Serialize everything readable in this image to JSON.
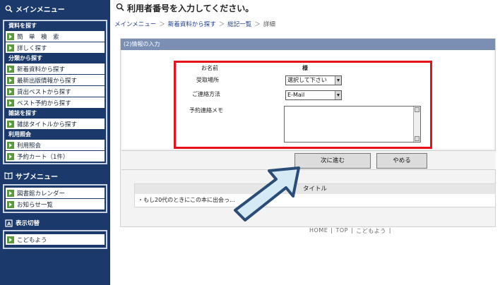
{
  "sidebar": {
    "main_menu_title": "メインメニュー",
    "sections": [
      {
        "label": "資料を探す",
        "items": [
          "簡　単　検　索",
          "詳しく探す"
        ]
      },
      {
        "label": "分類から探す",
        "items": [
          "新着資料から探す",
          "最新出版情報から探す",
          "貸出ベストから探す",
          "ベスト予約から探す"
        ]
      },
      {
        "label": "雑誌を探す",
        "items": [
          "雑誌タイトルから探す"
        ]
      },
      {
        "label": "利用照会",
        "items": [
          "利用照会",
          "予約カート（1件）"
        ]
      }
    ],
    "sub_menu_title": "サブメニュー",
    "sub_items": [
      "図書館カレンダー",
      "お知らせ一覧"
    ],
    "display_title": "表示切替",
    "display_items": [
      "こどもよう"
    ]
  },
  "header": {
    "title": "利用者番号を入力してください。"
  },
  "breadcrumb": {
    "items": [
      "メインメニュー",
      "新着資料から探す",
      "総記一覧",
      "詳細"
    ],
    "separator": "＞"
  },
  "panel": {
    "heading": "(2)情報の入力"
  },
  "form": {
    "name_label": "お名前",
    "name_suffix": "様",
    "pickup_label": "受取場所",
    "pickup_value": "選択して下さい",
    "contact_label": "ご連絡方法",
    "contact_value": "E-Mail",
    "memo_label": "予約連絡メモ"
  },
  "buttons": {
    "next": "次に進む",
    "cancel": "やめる"
  },
  "result_table": {
    "header": "タイトル",
    "row": "・もし20代のときにこの本に出会っ..."
  },
  "footer": {
    "home": "HOME",
    "top": "TOP",
    "kids": "こどもよう",
    "sep": "|"
  },
  "colors": {
    "sidebar_bg": "#1b3a6b",
    "highlight_border": "#e8101a",
    "panel_head": "#7b8fb5",
    "arrow_fill": "#d6eaf5",
    "arrow_stroke": "#2a4d78"
  }
}
